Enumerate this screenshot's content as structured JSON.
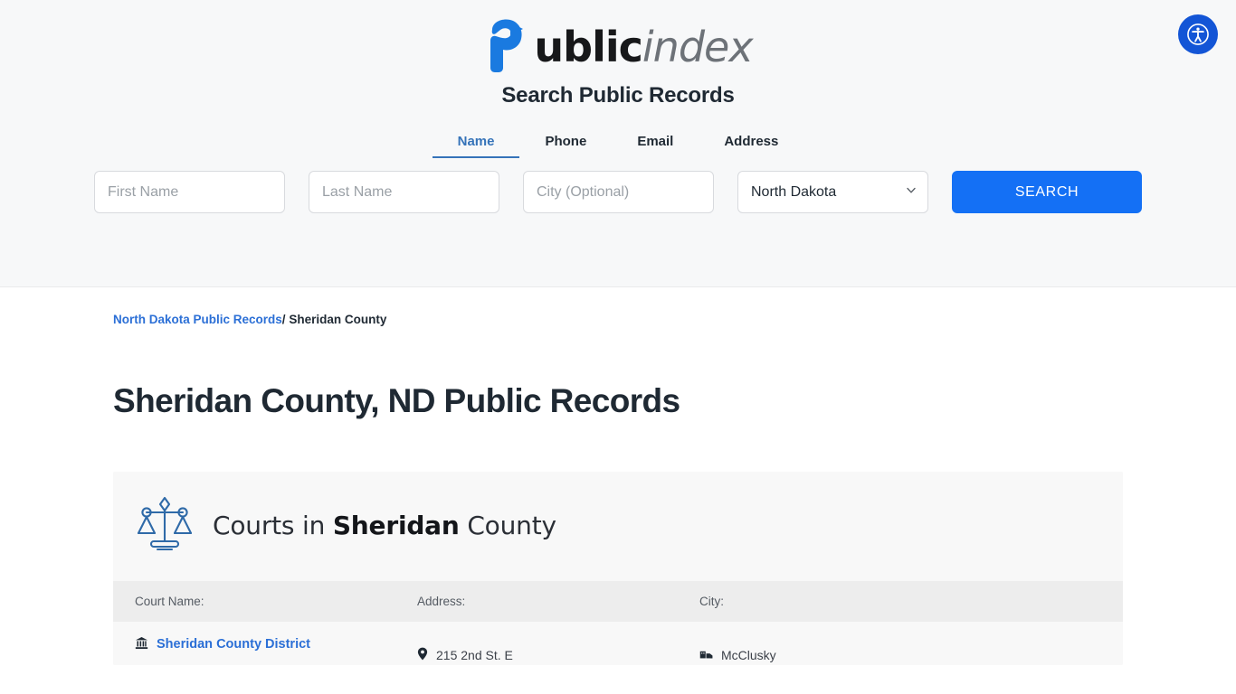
{
  "header": {
    "accessibility_button": {
      "name": "accessibility-button",
      "icon": "accessibility-icon",
      "color": "#1355d6"
    },
    "logo": {
      "mark": "p-arrow-logo-icon",
      "text_bold": "ublic",
      "text_italic": "index",
      "mark_color": "#1a7ae0"
    },
    "search_title": "Search Public Records",
    "tabs": [
      {
        "label": "Name",
        "active": true
      },
      {
        "label": "Phone",
        "active": false
      },
      {
        "label": "Email",
        "active": false
      },
      {
        "label": "Address",
        "active": false
      }
    ],
    "form": {
      "first_name_placeholder": "First Name",
      "first_name_value": "",
      "last_name_placeholder": "Last Name",
      "last_name_value": "",
      "city_placeholder": "City (Optional)",
      "city_value": "",
      "state_selected": "North Dakota",
      "state_options": [
        "North Dakota"
      ],
      "search_label": "SEARCH",
      "search_color": "#1470f5"
    }
  },
  "breadcrumb": {
    "parent_label": "North Dakota Public Records",
    "separator": "/",
    "current_label": "Sheridan County"
  },
  "page_title": "Sheridan County, ND Public Records",
  "courts_card": {
    "icon": "scales-of-justice-icon",
    "heading_prefix": "Courts in ",
    "heading_bold": "Sheridan",
    "heading_suffix": " County",
    "columns": [
      "Court Name:",
      "Address:",
      "City:"
    ],
    "rows": [
      {
        "court_name": "Sheridan County District",
        "court_name_icon": "courthouse-icon",
        "address": "215 2nd St. E",
        "address_icon": "map-pin-icon",
        "city": "McClusky",
        "city_icon": "city-buildings-icon"
      }
    ]
  }
}
